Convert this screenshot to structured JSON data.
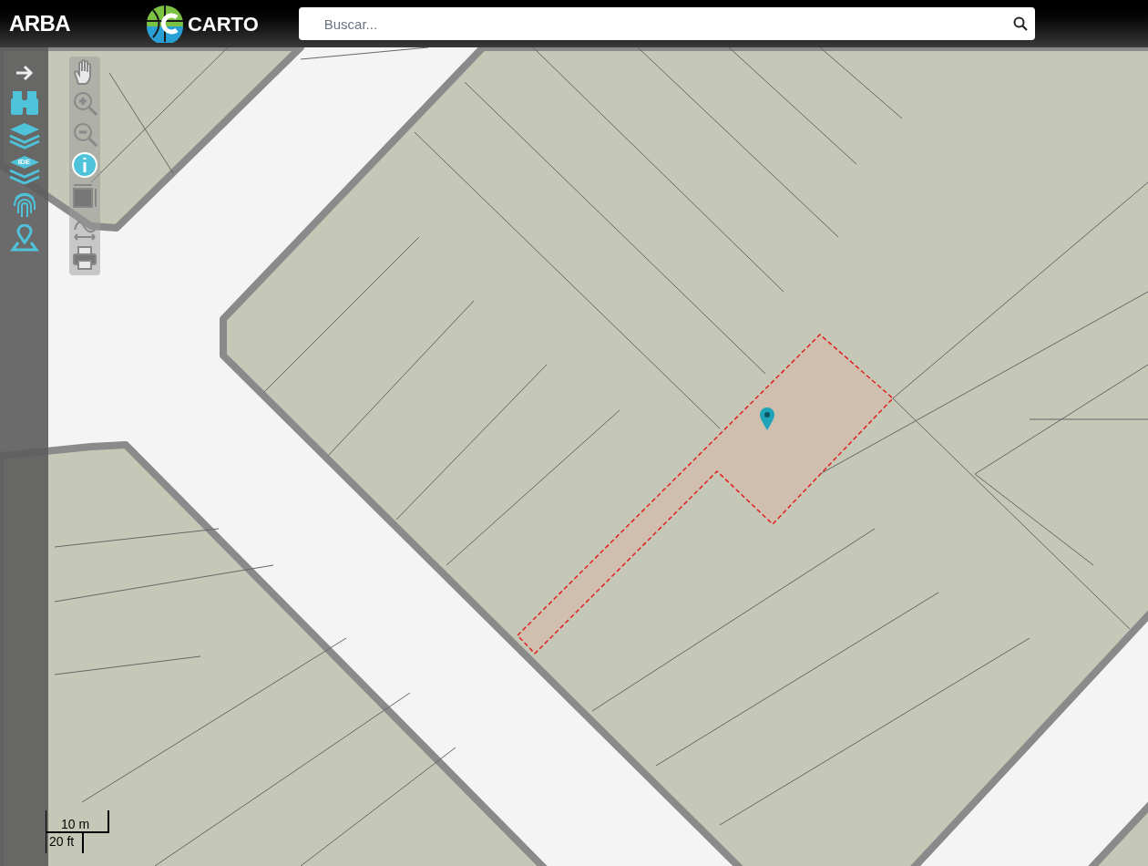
{
  "header": {
    "brand": "ARBA",
    "logo_text": "CARTO",
    "search": {
      "placeholder": "Buscar..."
    }
  },
  "sidebar": {
    "items": [
      {
        "kind": "arrow"
      },
      {
        "kind": "binoculars"
      },
      {
        "kind": "layers"
      },
      {
        "kind": "ide-layers",
        "label": "IDE"
      },
      {
        "kind": "fingerprint"
      },
      {
        "kind": "map-pin"
      }
    ]
  },
  "tools": [
    {
      "kind": "pan",
      "selected": false
    },
    {
      "kind": "zoom-in",
      "selected": false
    },
    {
      "kind": "zoom-out",
      "selected": false
    },
    {
      "kind": "info",
      "selected": true
    },
    {
      "kind": "box-zoom",
      "selected": false
    },
    {
      "kind": "measure",
      "selected": false
    },
    {
      "kind": "print",
      "selected": false
    }
  ],
  "scale_bar": {
    "metric": "10 m",
    "imperial": "20 ft"
  }
}
